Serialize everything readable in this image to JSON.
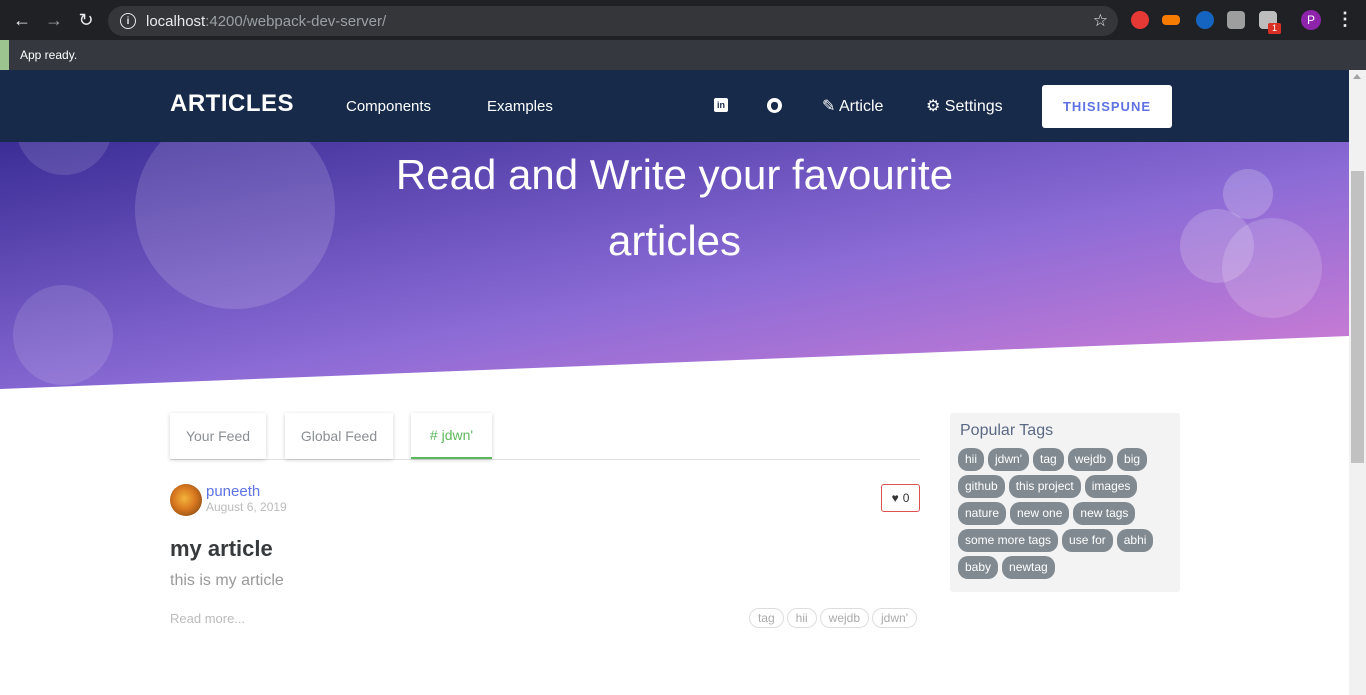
{
  "browser": {
    "url_host": "localhost",
    "url_path": ":4200/webpack-dev-server/",
    "extension_badge": "1",
    "profile_initial": "P"
  },
  "status": {
    "message": "App ready."
  },
  "header": {
    "brand": "ARTICLES",
    "nav": {
      "components": "Components",
      "examples": "Examples",
      "article": "Article",
      "settings": "Settings"
    },
    "user_button": "THISISPUNE"
  },
  "hero": {
    "title": "Read and Write your favourite articles"
  },
  "feed": {
    "tabs": {
      "your_feed": "Your Feed",
      "global_feed": "Global Feed",
      "tag_feed": "# jdwn'"
    }
  },
  "article": {
    "author": "puneeth",
    "date": "August 6, 2019",
    "likes": "0",
    "title": "my article",
    "description": "this is my article",
    "read_more": "Read more...",
    "tags": [
      "tag",
      "hii",
      "wejdb",
      "jdwn'"
    ]
  },
  "sidebar": {
    "title": "Popular Tags",
    "tags": [
      "hii",
      "jdwn'",
      "tag",
      "wejdb",
      "big",
      "github",
      "this project",
      "images",
      "nature",
      "new one",
      "new tags",
      "some more tags",
      "use for",
      "abhi",
      "baby",
      "newtag"
    ]
  },
  "colors": {
    "header_bg": "#172a4a",
    "accent_blue": "#5e72e4",
    "active_tab": "#5cb85c",
    "hero_start": "#3b2d96",
    "hero_end": "#d67fd4"
  }
}
